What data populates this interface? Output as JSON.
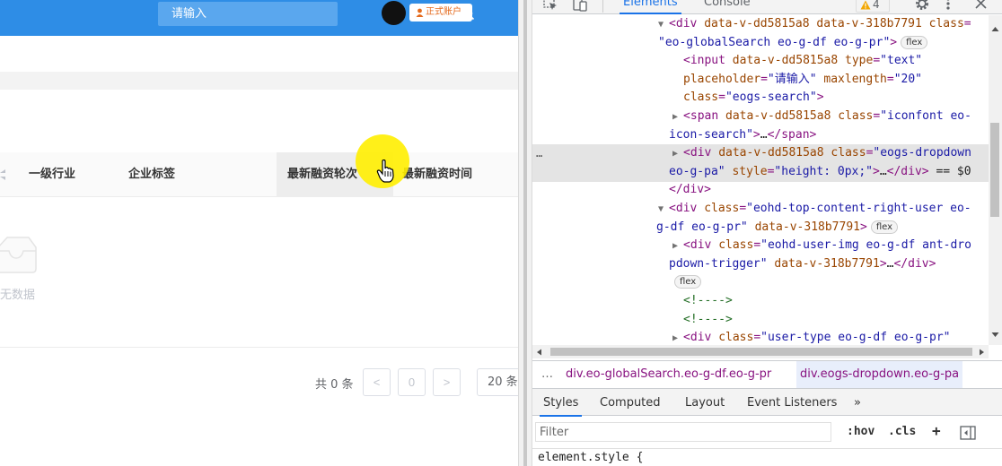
{
  "app": {
    "search": {
      "placeholder": "请输入"
    },
    "user_type_label": "正式账户",
    "table_headers": [
      {
        "label": "一级行业"
      },
      {
        "label": "企业标签"
      },
      {
        "label": "最新融资轮次"
      },
      {
        "label": "最新融资时间"
      }
    ],
    "empty_text": "无数据",
    "pagination": {
      "total": "共 0 条",
      "prev": "<",
      "current_page": "0",
      "next": ">",
      "page_size": "20 条"
    }
  },
  "devtools": {
    "tabs": [
      "Elements",
      "Console"
    ],
    "active_tab": "Elements",
    "warning_count": "4",
    "dom_lines": [
      {
        "arrow": "▼",
        "parts": [
          [
            "p",
            "<div "
          ],
          [
            "a",
            "data-v-dd5815a8 data-v-318b7791 "
          ],
          [
            "a",
            "class"
          ],
          [
            "p",
            "="
          ]
        ],
        "tail_value": "\""
      },
      {
        "parts": [
          [
            "v",
            "\"eo-globalSearch eo-g-df eo-g-pr\""
          ],
          [
            "p",
            ">"
          ]
        ],
        "badge": "flex"
      },
      {
        "parts": [
          [
            "p",
            "<input "
          ],
          [
            "a",
            "data-v-dd5815a8 type"
          ],
          [
            "p",
            "="
          ],
          [
            "v",
            "\"text\""
          ]
        ]
      },
      {
        "parts": [
          [
            "a",
            "placeholder"
          ],
          [
            "p",
            "="
          ],
          [
            "v",
            "\"请输入\""
          ],
          [
            "a",
            " maxlength"
          ],
          [
            "p",
            "="
          ],
          [
            "v",
            "\"20\""
          ]
        ]
      },
      {
        "parts": [
          [
            "a",
            "class"
          ],
          [
            "p",
            "="
          ],
          [
            "v",
            "\"eogs-search\""
          ],
          [
            "p",
            ">"
          ]
        ]
      },
      {
        "arrow": "▶",
        "parts": [
          [
            "p",
            "<span "
          ],
          [
            "a",
            "data-v-dd5815a8 class"
          ],
          [
            "p",
            "="
          ],
          [
            "v",
            "\"iconfont eo-"
          ]
        ]
      },
      {
        "parts": [
          [
            "v",
            "icon-search\""
          ],
          [
            "p",
            ">"
          ],
          [
            "txt",
            "…"
          ],
          [
            "p",
            "</span>"
          ]
        ]
      },
      {
        "arrow": "▶",
        "selected": true,
        "parts": [
          [
            "p",
            "<div "
          ],
          [
            "a",
            "data-v-dd5815a8 class"
          ],
          [
            "p",
            "="
          ],
          [
            "v",
            "\"eogs-dropdown"
          ]
        ]
      },
      {
        "selected": true,
        "parts": [
          [
            "v",
            "eo-g-pa\""
          ],
          [
            "a",
            " style"
          ],
          [
            "p",
            "="
          ],
          [
            "v",
            "\"height: 0px;\""
          ],
          [
            "p",
            ">"
          ],
          [
            "txt",
            "…"
          ],
          [
            "p",
            "</div>"
          ],
          [
            "txt",
            " == $0"
          ]
        ]
      },
      {
        "parts": [
          [
            "p",
            "</div>"
          ]
        ]
      },
      {
        "arrow": "▼",
        "parts": [
          [
            "p",
            "<div "
          ],
          [
            "a",
            "class"
          ],
          [
            "p",
            "="
          ],
          [
            "v",
            "\"eohd-top-content-right-user eo-"
          ]
        ]
      },
      {
        "parts": [
          [
            "v",
            "g-df eo-g-pr\""
          ],
          [
            "a",
            " data-v-318b7791"
          ],
          [
            "p",
            ">"
          ]
        ],
        "badge": "flex"
      },
      {
        "arrow": "▶",
        "parts": [
          [
            "p",
            "<div "
          ],
          [
            "a",
            "class"
          ],
          [
            "p",
            "="
          ],
          [
            "v",
            "\"eohd-user-img eo-g-df ant-dro"
          ]
        ]
      },
      {
        "parts": [
          [
            "v",
            "pdown-trigger\""
          ],
          [
            "a",
            " data-v-318b7791"
          ],
          [
            "p",
            ">"
          ],
          [
            "txt",
            "…"
          ],
          [
            "p",
            "</div>"
          ]
        ]
      },
      {
        "badge_only": true,
        "badge": "flex"
      },
      {
        "parts": [
          [
            "cm",
            "<!---->"
          ]
        ]
      },
      {
        "parts": [
          [
            "cm",
            "<!---->"
          ]
        ]
      },
      {
        "arrow": "▶",
        "parts": [
          [
            "p",
            "<div "
          ],
          [
            "a",
            "class"
          ],
          [
            "p",
            "="
          ],
          [
            "v",
            "\"user-type eo-g-df eo-g-pr\""
          ]
        ]
      }
    ],
    "selected_dots": "…",
    "breadcrumb": {
      "dots": "…",
      "items": [
        "div.eo-globalSearch.eo-g-df.eo-g-pr",
        "div.eogs-dropdown.eo-g-pa"
      ]
    },
    "styles_tabs": [
      "Styles",
      "Computed",
      "Layout",
      "Event Listeners",
      "»"
    ],
    "filter_placeholder": "Filter",
    "hov_label": ":hov",
    "cls_label": ".cls",
    "plus_label": "+",
    "element_style": "element.style {"
  }
}
